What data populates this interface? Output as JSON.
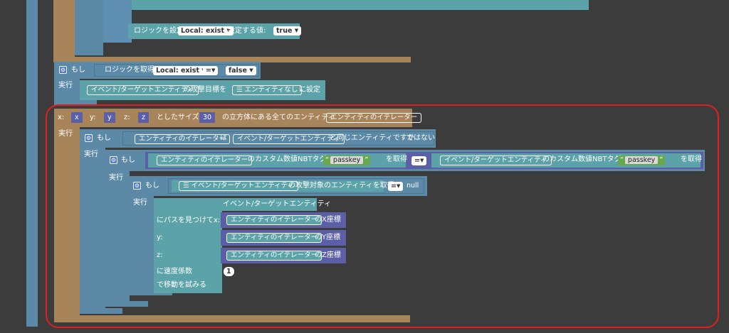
{
  "colors": {
    "workspace": "#3c3c3c",
    "highlight": "#e02020",
    "logic": "#5b89a6",
    "action": "#5ba3a8",
    "loop": "#a7845a",
    "variable": "#5b5fa6",
    "text": "#6aa84f"
  },
  "block_set_logic": {
    "label": "ロジックを設定",
    "var": "Local: exist",
    "value_label": "設定する値:",
    "value": "true"
  },
  "block_if1": {
    "if_label": "もし",
    "do_label": "実行",
    "get_logic": "ロジックを取得",
    "var": "Local: exist",
    "op": "=",
    "value": "false",
    "target": "イベント/ターゲットエンティティ",
    "mid": "の攻撃目標を",
    "entity": "エンティティなし",
    "suffix": "に設定"
  },
  "block_loop": {
    "x_label": "x:",
    "x_val": "x",
    "y_label": "y:",
    "y_val": "y",
    "z_label": "z:",
    "z_val": "z",
    "size_label": "としたサイズ",
    "size": "30",
    "cube_label": "の立方体にある全てのエンティティ",
    "iterator": "エンティティのイテレーター",
    "do_label": "実行"
  },
  "block_if2": {
    "if_label": "もし",
    "do_label": "実行",
    "iterator": "エンティティのイテレーター",
    "wa": "は",
    "target": "イベント/ターゲットエンティティ",
    "same": "と同じエンティティですか",
    "not": "ではない"
  },
  "block_if3": {
    "if_label": "もし",
    "do_label": "実行",
    "iterator": "エンティティのイテレーター",
    "nbt": "のカスタム数値NBTタグ",
    "key": "passkey",
    "get": "を取得",
    "op": "=",
    "target": "イベント/ターゲットエンティティ",
    "nbt2": "のカスタム数値NBTタグ",
    "key2": "passkey",
    "get2": "を取得"
  },
  "block_if4": {
    "if_label": "もし",
    "do_label": "実行",
    "target": "イベント/ターゲットエンティティ",
    "attack": "の攻撃対象のエンティティを取得",
    "op": "=",
    "null": "null"
  },
  "block_path": {
    "target": "イベント/ターゲットエンティティ",
    "path_x": "にパスを見つけてx:",
    "y_label": "y:",
    "z_label": "z:",
    "iterator": "エンティティのイテレーター",
    "x_coord": "のX座標",
    "y_coord": "のY座標",
    "z_coord": "のZ座標",
    "speed": "に速度係数",
    "speed_val": "1",
    "try_move": "で移動を試みる"
  }
}
